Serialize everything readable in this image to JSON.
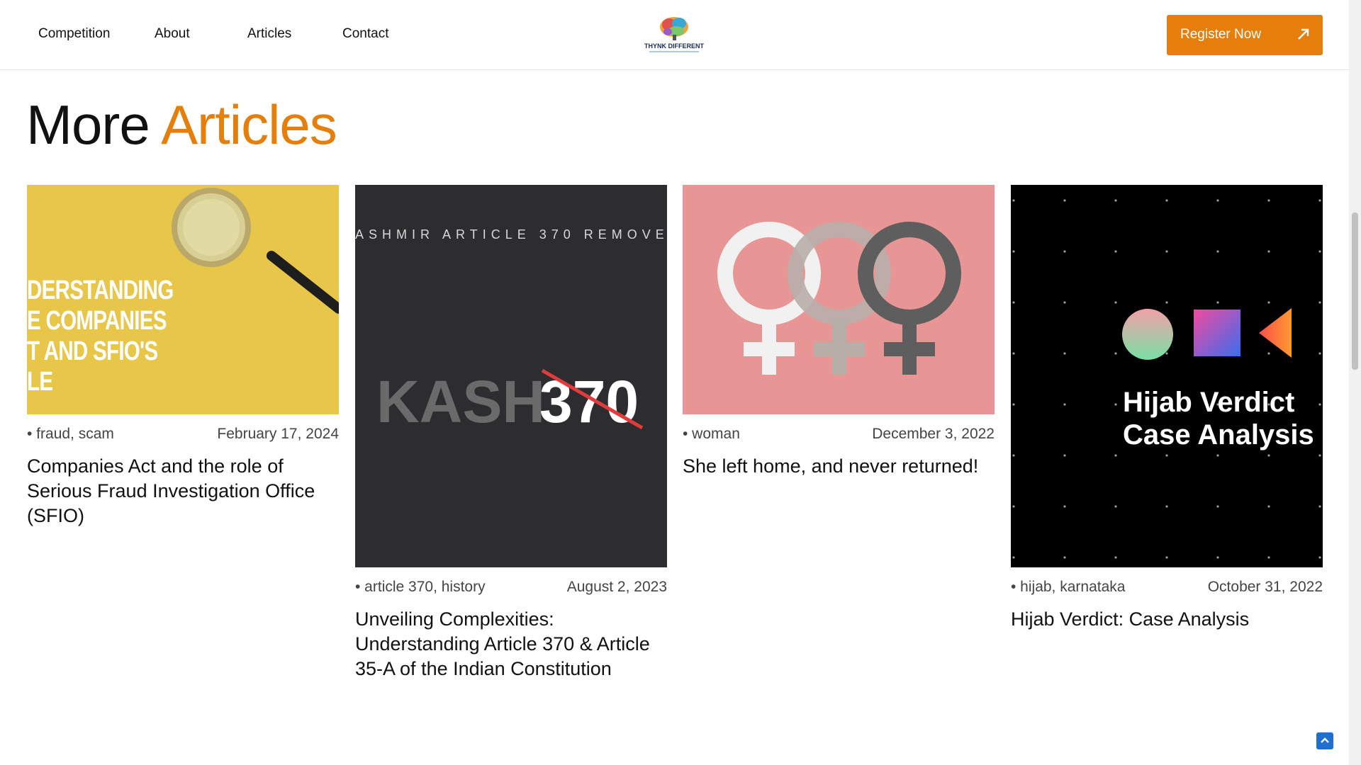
{
  "nav": {
    "items": [
      {
        "label": "Competition"
      },
      {
        "label": "About"
      },
      {
        "label": "Articles"
      },
      {
        "label": "Contact"
      }
    ],
    "logo_text": "THYNK DIFFERENT",
    "register_label": "Register Now",
    "register_icon": "arrow-up-right-icon"
  },
  "section": {
    "title_plain": "More",
    "title_accent": "Articles",
    "accent_color": "#e67e0b"
  },
  "cards": [
    {
      "tags": "• fraud, scam",
      "date": "February 17, 2024",
      "title": "Companies Act and the role of Serious Fraud Investigation Office (SFIO)",
      "image_text": [
        "DERSTANDING",
        "E COMPANIES",
        "T AND SFIO'S",
        "LE"
      ]
    },
    {
      "tags": "• article 370, history",
      "date": "August 2, 2023",
      "title": "Unveiling Complexities: Understanding Article 370 & Article 35-A of the Indian Constitution",
      "image_text": {
        "top": "ASHMIR ARTICLE 370 REMOVE",
        "main": "KASH",
        "num": "370"
      }
    },
    {
      "tags": "• woman",
      "date": "December 3, 2022",
      "title": "She left home, and never returned!"
    },
    {
      "tags": "• hijab, karnataka",
      "date": "October 31, 2022",
      "title": "Hijab Verdict: Case Analysis",
      "image_text": [
        "Hijab Verdict",
        "Case Analysis"
      ]
    }
  ]
}
